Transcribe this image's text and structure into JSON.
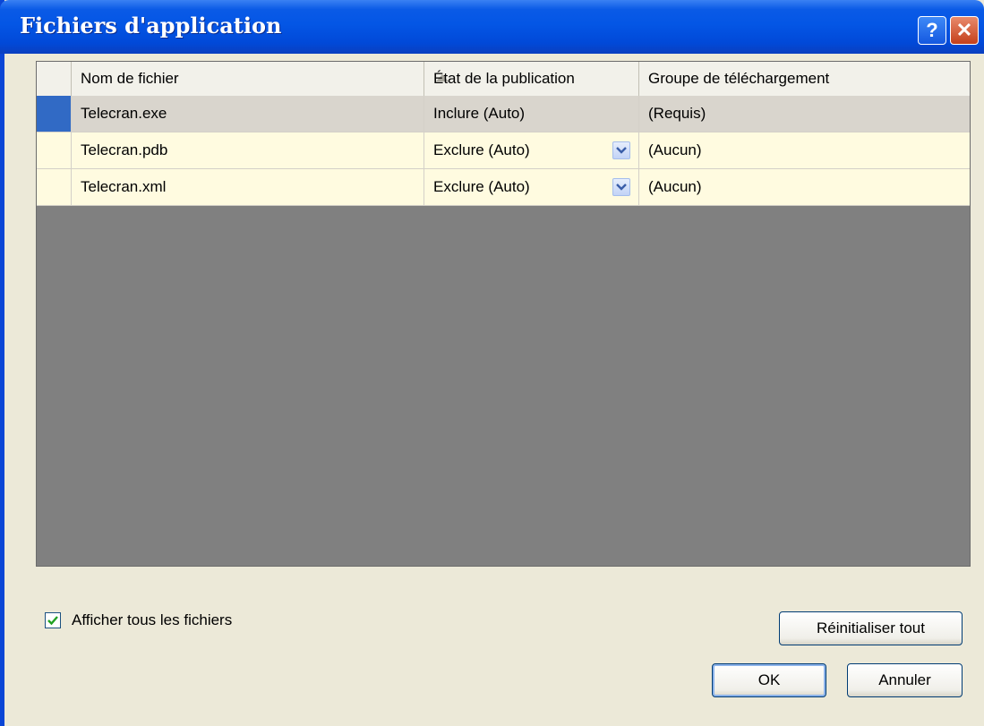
{
  "window": {
    "title": "Fichiers d'application",
    "help_glyph": "?",
    "close_glyph": "✕"
  },
  "grid": {
    "columns": [
      "Nom de fichier",
      "État de la publication",
      "Groupe de téléchargement"
    ],
    "rows": [
      {
        "file": "Telecran.exe",
        "status": "Inclure (Auto)",
        "group": "(Requis)",
        "selected": true,
        "has_dropdown": false
      },
      {
        "file": "Telecran.pdb",
        "status": "Exclure (Auto)",
        "group": "(Aucun)",
        "selected": false,
        "has_dropdown": true
      },
      {
        "file": "Telecran.xml",
        "status": "Exclure (Auto)",
        "group": "(Aucun)",
        "selected": false,
        "has_dropdown": true
      }
    ]
  },
  "show_all": {
    "label": "Afficher tous les fichiers",
    "checked": true
  },
  "buttons": {
    "reset": "Réinitialiser tout",
    "ok": "OK",
    "cancel": "Annuler"
  },
  "colors": {
    "titlebar": "#0456e5",
    "selection": "#316ac5",
    "grid_background": "#808080",
    "row_background": "#fffbe0"
  }
}
